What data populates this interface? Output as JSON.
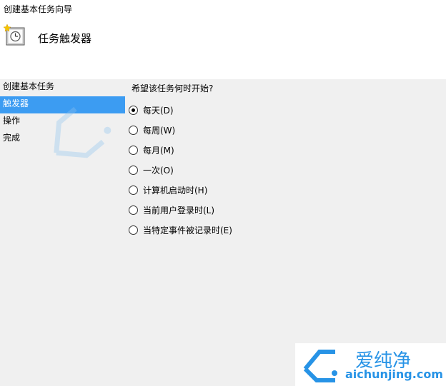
{
  "window": {
    "title": "创建基本任务向导"
  },
  "header": {
    "icon": "clock-task-icon",
    "title": "任务触发器"
  },
  "nav": {
    "items": [
      {
        "label": "创建基本任务",
        "active": false
      },
      {
        "label": "触发器",
        "active": true
      },
      {
        "label": "操作",
        "active": false
      },
      {
        "label": "完成",
        "active": false
      }
    ]
  },
  "main": {
    "question": "希望该任务何时开始?",
    "options": [
      {
        "label": "每天(D)",
        "checked": true
      },
      {
        "label": "每周(W)",
        "checked": false
      },
      {
        "label": "每月(M)",
        "checked": false
      },
      {
        "label": "一次(O)",
        "checked": false
      },
      {
        "label": "计算机启动时(H)",
        "checked": false
      },
      {
        "label": "当前用户登录时(L)",
        "checked": false
      },
      {
        "label": "当特定事件被记录时(E)",
        "checked": false
      }
    ]
  },
  "watermark": {
    "brand": "爱纯净",
    "site": "aichunjing.com",
    "color": "#2793e6"
  }
}
